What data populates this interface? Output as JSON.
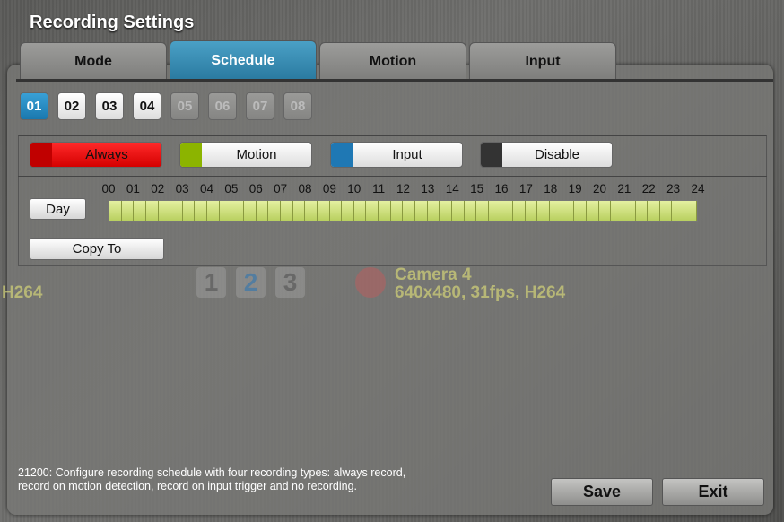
{
  "window": {
    "title": "Recording Settings"
  },
  "tabs": [
    {
      "label": "Mode",
      "active": false
    },
    {
      "label": "Schedule",
      "active": true
    },
    {
      "label": "Motion",
      "active": false
    },
    {
      "label": "Input",
      "active": false
    }
  ],
  "channels": [
    {
      "label": "01",
      "state": "selected"
    },
    {
      "label": "02",
      "state": "enabled"
    },
    {
      "label": "03",
      "state": "enabled"
    },
    {
      "label": "04",
      "state": "enabled"
    },
    {
      "label": "05",
      "state": "disabled"
    },
    {
      "label": "06",
      "state": "disabled"
    },
    {
      "label": "07",
      "state": "disabled"
    },
    {
      "label": "08",
      "state": "disabled"
    }
  ],
  "modes": [
    {
      "label": "Always",
      "color": "#e00000",
      "selected": true
    },
    {
      "label": "Motion",
      "color": "#8cb400",
      "selected": false
    },
    {
      "label": "Input",
      "color": "#1f78b4",
      "selected": false
    },
    {
      "label": "Disable",
      "color": "#333333",
      "selected": false
    }
  ],
  "schedule": {
    "day_button": "Day",
    "hours": [
      "00",
      "01",
      "02",
      "03",
      "04",
      "05",
      "06",
      "07",
      "08",
      "09",
      "10",
      "11",
      "12",
      "13",
      "14",
      "15",
      "16",
      "17",
      "18",
      "19",
      "20",
      "21",
      "22",
      "23",
      "24"
    ],
    "slot_color": "#c8dc78",
    "slots": 48,
    "slot_mode": "Motion"
  },
  "copy_to": "Copy To",
  "background_overlay": {
    "camera_numbers": [
      "1",
      "2",
      "3"
    ],
    "camera_name": "Camera 4",
    "camera_info": "640x480, 31fps, H264",
    "left_info": "H264"
  },
  "help_text": "21200: Configure recording schedule with four recording types: always record, record on motion detection, record on input trigger and no recording.",
  "footer": {
    "save": "Save",
    "exit": "Exit"
  }
}
